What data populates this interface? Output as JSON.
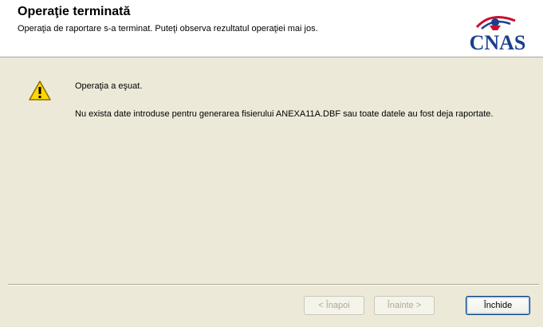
{
  "header": {
    "title": "Operaţie terminată",
    "subtitle": "Operaţia de raportare s-a terminat. Puteţi observa rezultatul operaţiei mai jos.",
    "logo_text": "CNAS"
  },
  "message": {
    "icon": "warning-icon",
    "status": "Operaţia a eşuat.",
    "detail": "Nu exista date introduse pentru generarea fisierului ANEXA11A.DBF sau toate datele au fost deja raportate."
  },
  "buttons": {
    "back_label": "< Înapoi",
    "next_label": "Înainte >",
    "close_label": "Închide"
  },
  "colors": {
    "dialog_background": "#ece9d8",
    "header_background": "#ffffff",
    "logo_blue": "#1b3f8f",
    "logo_red": "#c8102e",
    "warning_yellow": "#ffd800"
  }
}
